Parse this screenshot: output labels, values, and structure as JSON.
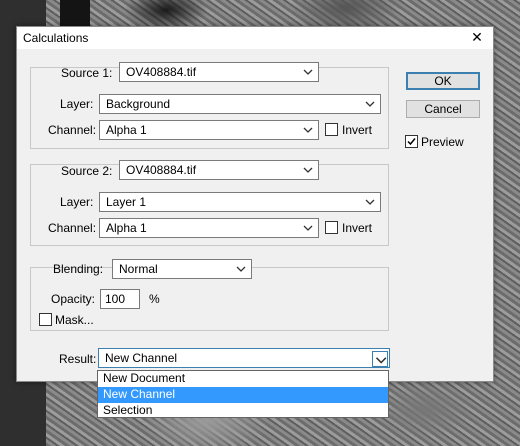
{
  "dialog": {
    "title": "Calculations",
    "close_glyph": "✕",
    "source1": {
      "label": "Source 1:",
      "file": "OV408884.tif",
      "layer_label": "Layer:",
      "layer": "Background",
      "channel_label": "Channel:",
      "channel": "Alpha 1",
      "invert_label": "Invert",
      "invert_checked": false
    },
    "source2": {
      "label": "Source 2:",
      "file": "OV408884.tif",
      "layer_label": "Layer:",
      "layer": "Layer 1",
      "channel_label": "Channel:",
      "channel": "Alpha 1",
      "invert_label": "Invert",
      "invert_checked": false
    },
    "blending": {
      "label": "Blending:",
      "mode": "Normal",
      "opacity_label": "Opacity:",
      "opacity_value": "100",
      "opacity_unit": "%",
      "mask_label": "Mask...",
      "mask_checked": false
    },
    "result": {
      "label": "Result:",
      "value": "New Channel",
      "options": [
        "New Document",
        "New Channel",
        "Selection"
      ],
      "selected_index": 1
    },
    "buttons": {
      "ok": "OK",
      "cancel": "Cancel"
    },
    "preview": {
      "label": "Preview",
      "checked": true
    }
  },
  "colors": {
    "accent": "#3c7fb1",
    "selection_highlight": "#3399ff",
    "dialog_bg": "#f0f0f0"
  }
}
